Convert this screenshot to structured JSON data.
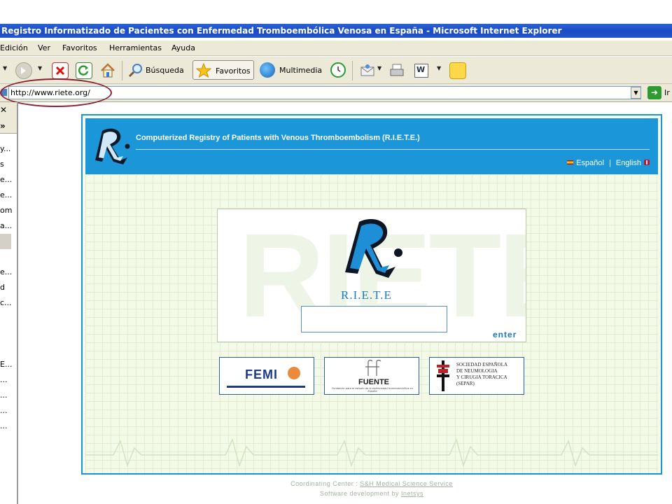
{
  "window": {
    "title": "Registro Informatizado de Pacientes con Enfermedad Tromboembólica Venosa en España - Microsoft Internet Explorer"
  },
  "menu": [
    "Edición",
    "Ver",
    "Favoritos",
    "Herramientas",
    "Ayuda"
  ],
  "toolbar": {
    "search_label": "Búsqueda",
    "favorites_label": "Favoritos",
    "multimedia_label": "Multimedia"
  },
  "address": {
    "url": "http://www.riete.org/",
    "go_label": "Ir"
  },
  "sidebar": {
    "close_glyph": "✕",
    "expand_glyph": "»",
    "items": [
      "y...",
      "s",
      "e...",
      "e...",
      "om",
      "a...",
      "e...",
      "d",
      "c...",
      "E...",
      "...",
      "...",
      "...",
      "..."
    ]
  },
  "page": {
    "header_title": "Computerized Registry of Patients with Venous Thromboembolism (R.I.E.T.E.)",
    "lang_spanish": "Español",
    "lang_separator": "|",
    "lang_english": "English",
    "logo_text": "R.I.E.T.E",
    "enter_label": "enter",
    "watermark": "RIETE",
    "partners": {
      "femi": "FEMI",
      "fuente": "FUENTE",
      "fuente_caption": "Fundación para el estudio de la enfermedad tromboembólica en España",
      "separ_lines": [
        "SOCIEDAD ESPAÑOLA",
        "DE NEUMOLOGIA",
        "Y CIRUGIA TORACICA",
        "(SEPAR)"
      ]
    },
    "footer": {
      "coordinating_label": "Coordinating Center :",
      "coordinating_link": "S&H Medical Science Service",
      "software_label": "Software development by",
      "software_link": "Inetsys"
    }
  },
  "colors": {
    "header_blue": "#1b96d8",
    "page_bg": "#f4fae8",
    "highlight_ring": "#8a2130"
  }
}
